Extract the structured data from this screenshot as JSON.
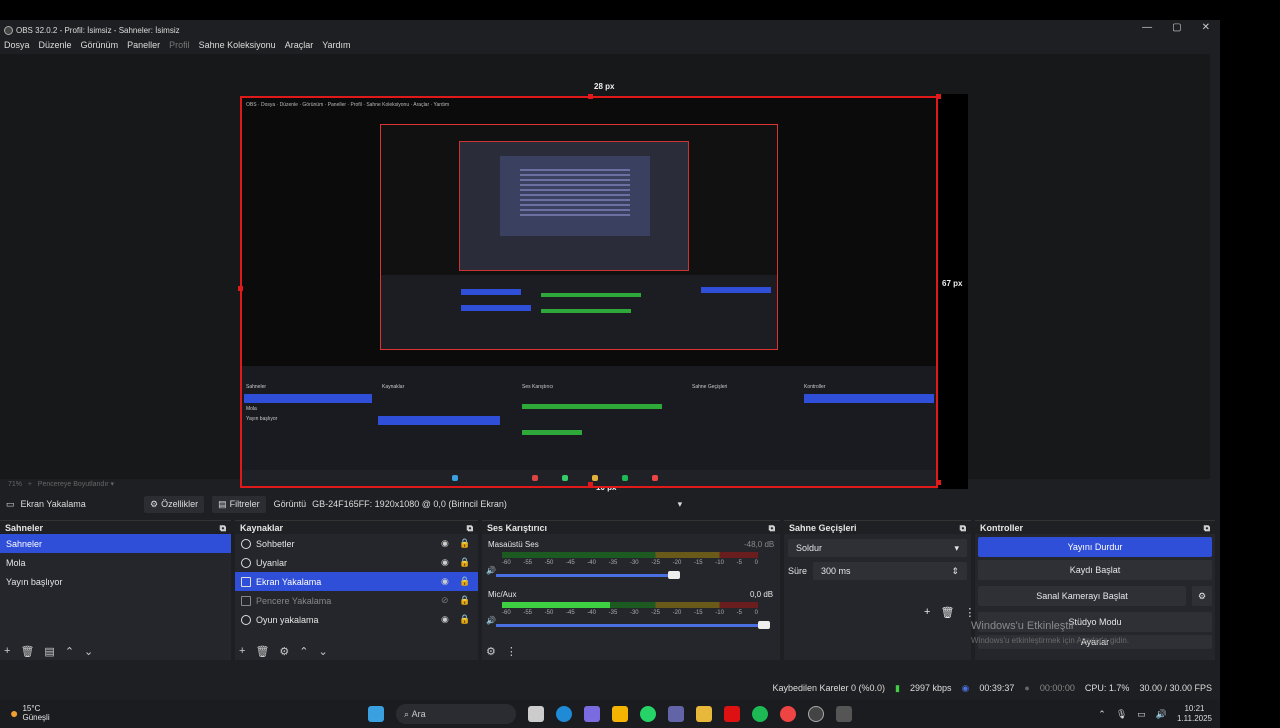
{
  "window": {
    "title": "OBS 32.0.2 - Profil: İsimsiz - Sahneler: İsimsiz",
    "controls": {
      "min": "—",
      "max": "▢",
      "close": "✕"
    }
  },
  "menu": [
    "Dosya",
    "Düzenle",
    "Görünüm",
    "Paneller",
    "Profil",
    "Sahne Koleksiyonu",
    "Araçlar",
    "Yardım"
  ],
  "preview": {
    "top_margin": "28 px",
    "right_margin": "67 px",
    "bottom_margin": "10 px",
    "zoom": "71%",
    "fit_mode": "Pencereye Boyutlandır"
  },
  "source_bar": {
    "source_name": "Ekran Yakalama",
    "properties": "Özellikler",
    "filters": "Filtreler",
    "display_label": "Görüntü",
    "display_value": "GB-24F165FF: 1920x1080 @ 0,0 (Birincil Ekran)"
  },
  "scenes": {
    "title": "Sahneler",
    "items": [
      "Sahneler",
      "Mola",
      "Yayın başlıyor"
    ]
  },
  "sources": {
    "title": "Kaynaklar",
    "items": [
      "Sohbetler",
      "Uyanlar",
      "Ekran Yakalama",
      "Pencere Yakalama",
      "Oyun yakalama"
    ]
  },
  "mixer": {
    "title": "Ses Karıştırıcı",
    "tracks": [
      {
        "name": "Masaüstü Ses",
        "db": "-48,0 dB",
        "level": 0.0
      },
      {
        "name": "Mic/Aux",
        "db": "0,0 dB",
        "level": 0.42
      }
    ],
    "ticks": [
      "-60",
      "-55",
      "-50",
      "-45",
      "-40",
      "-35",
      "-30",
      "-25",
      "-20",
      "-15",
      "-10",
      "-5",
      "0"
    ]
  },
  "transitions": {
    "title": "Sahne Geçişleri",
    "type": "Soldur",
    "duration_label": "Süre",
    "duration": "300 ms"
  },
  "controls": {
    "title": "Kontroller",
    "stop_stream": "Yayını Durdur",
    "start_record": "Kaydı Başlat",
    "virtual_cam": "Sanal Kamerayı Başlat",
    "studio_mode": "Stüdyo Modu",
    "settings": "Ayarlar"
  },
  "watermark": {
    "line1": "Windows'u Etkinleştir",
    "line2": "Windows'u etkinleştirmek için Ayarlar'a gidin."
  },
  "status": {
    "dropped": "Kaybedilen Kareler 0 (%0.0)",
    "bitrate": "2997 kbps",
    "stream_time": "00:39:37",
    "rec_time": "00:00:00",
    "cpu": "CPU: 1.7%",
    "fps": "30.00 / 30.00 FPS"
  },
  "taskbar": {
    "weather_temp": "15°C",
    "weather_desc": "Güneşli",
    "search": "Ara",
    "time": "10:21",
    "date": "1.11.2025"
  },
  "colors": {
    "accent": "#2f4fd8",
    "border_red": "#e01a1a",
    "meter_green": "#3ecf43"
  }
}
